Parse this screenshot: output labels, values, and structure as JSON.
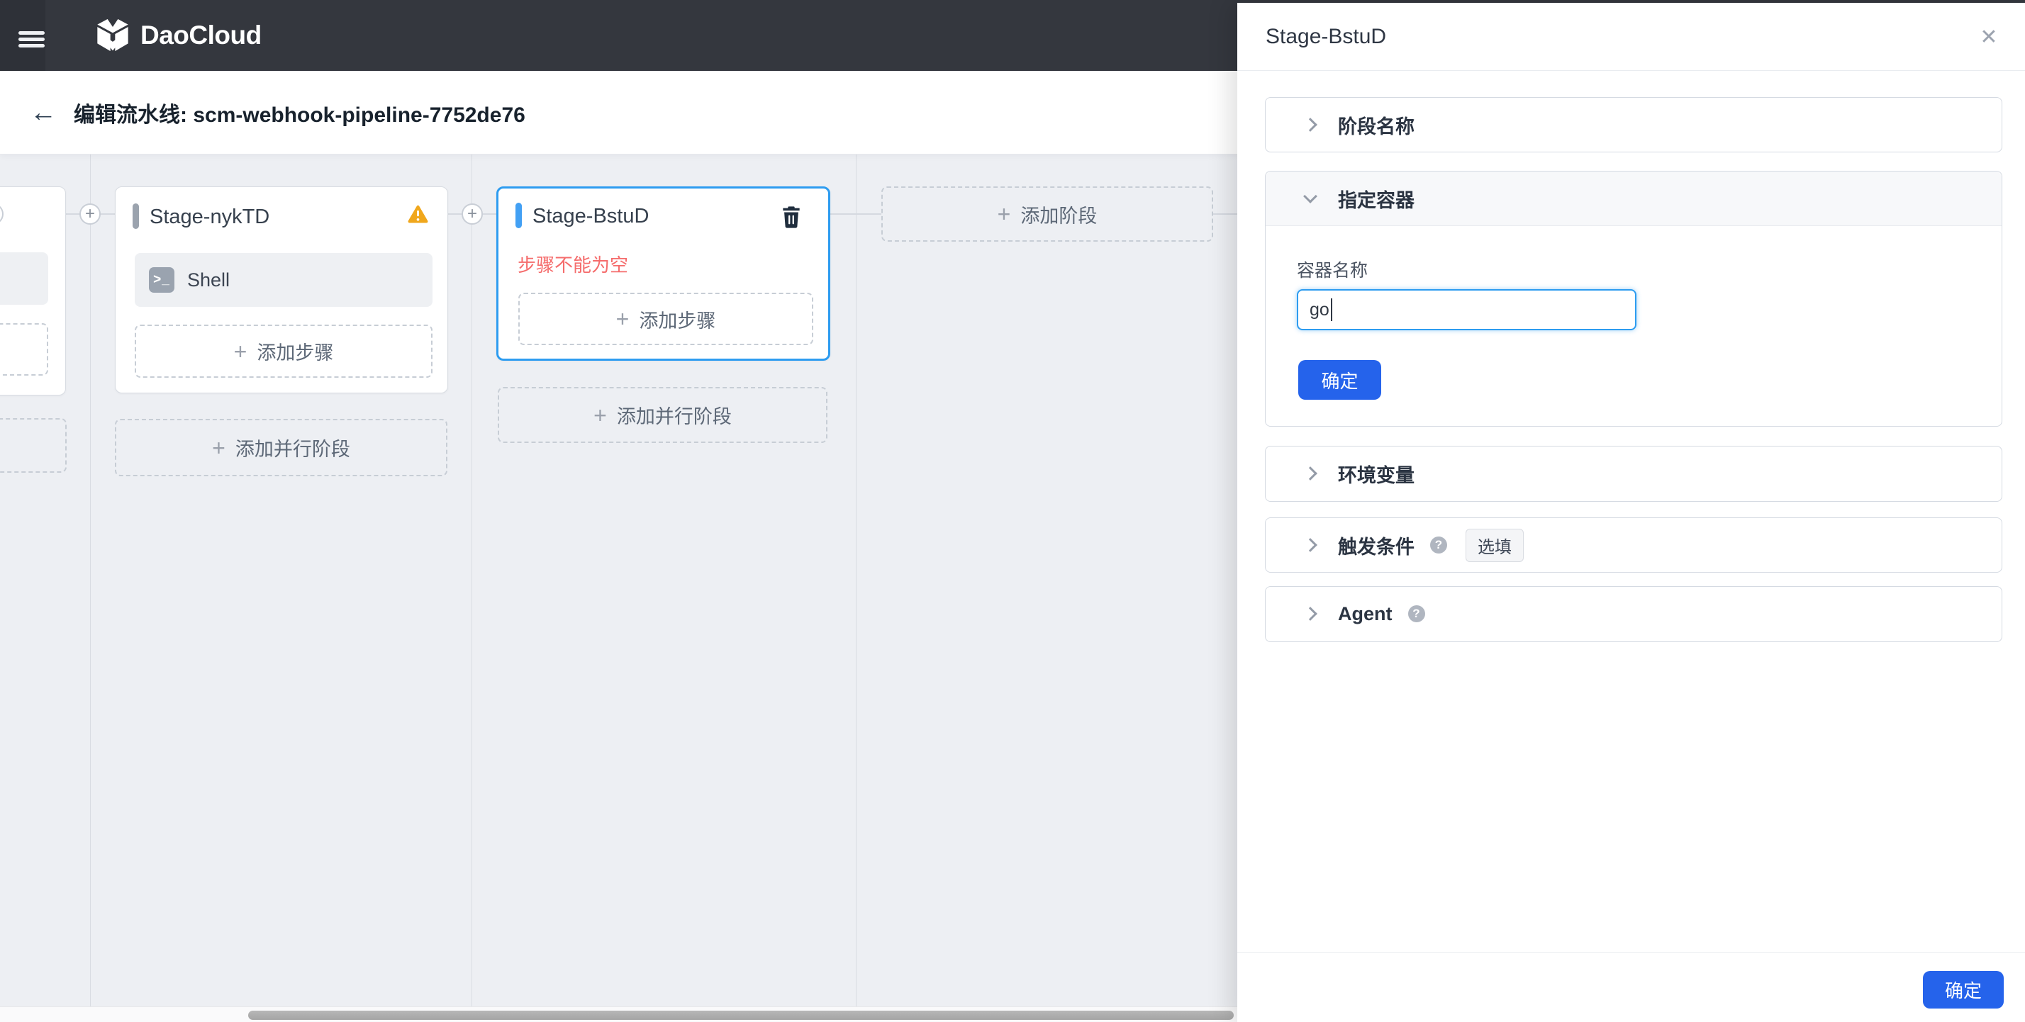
{
  "topbar": {
    "logo_text": "DaoCloud"
  },
  "title_bar": {
    "title": "编辑流水线: scm-webhook-pipeline-7752de76"
  },
  "icons": {
    "plus": "+",
    "close": "✕",
    "back": "←",
    "help": "?",
    "terminal": ">_"
  },
  "canvas": {
    "stage_nyktd": {
      "name": "Stage-nykTD",
      "step_label": "Shell",
      "add_step": "添加步骤",
      "add_parallel": "添加并行阶段"
    },
    "stage_bstud": {
      "name": "Stage-BstuD",
      "error": "步骤不能为空",
      "add_step": "添加步骤",
      "add_parallel": "添加并行阶段"
    },
    "add_stage": "添加阶段"
  },
  "drawer": {
    "title": "Stage-BstuD",
    "section_stage_name": {
      "title": "阶段名称"
    },
    "section_container": {
      "title": "指定容器",
      "field_label": "容器名称",
      "field_value": "go",
      "confirm": "确定"
    },
    "section_env": {
      "title": "环境变量"
    },
    "section_trigger": {
      "title": "触发条件",
      "badge": "选填"
    },
    "section_agent": {
      "title": "Agent"
    },
    "footer": {
      "confirm": "确定"
    }
  },
  "colors": {
    "accent_blue": "#2563eb",
    "focus_blue": "#2d9cf0",
    "stage_bar_gray": "#9ba3ae",
    "stage_bar_blue": "#42a0f4",
    "warning_amber": "#f0a71c",
    "error_red": "#f56c6c",
    "topbar_dark": "#34373e"
  }
}
